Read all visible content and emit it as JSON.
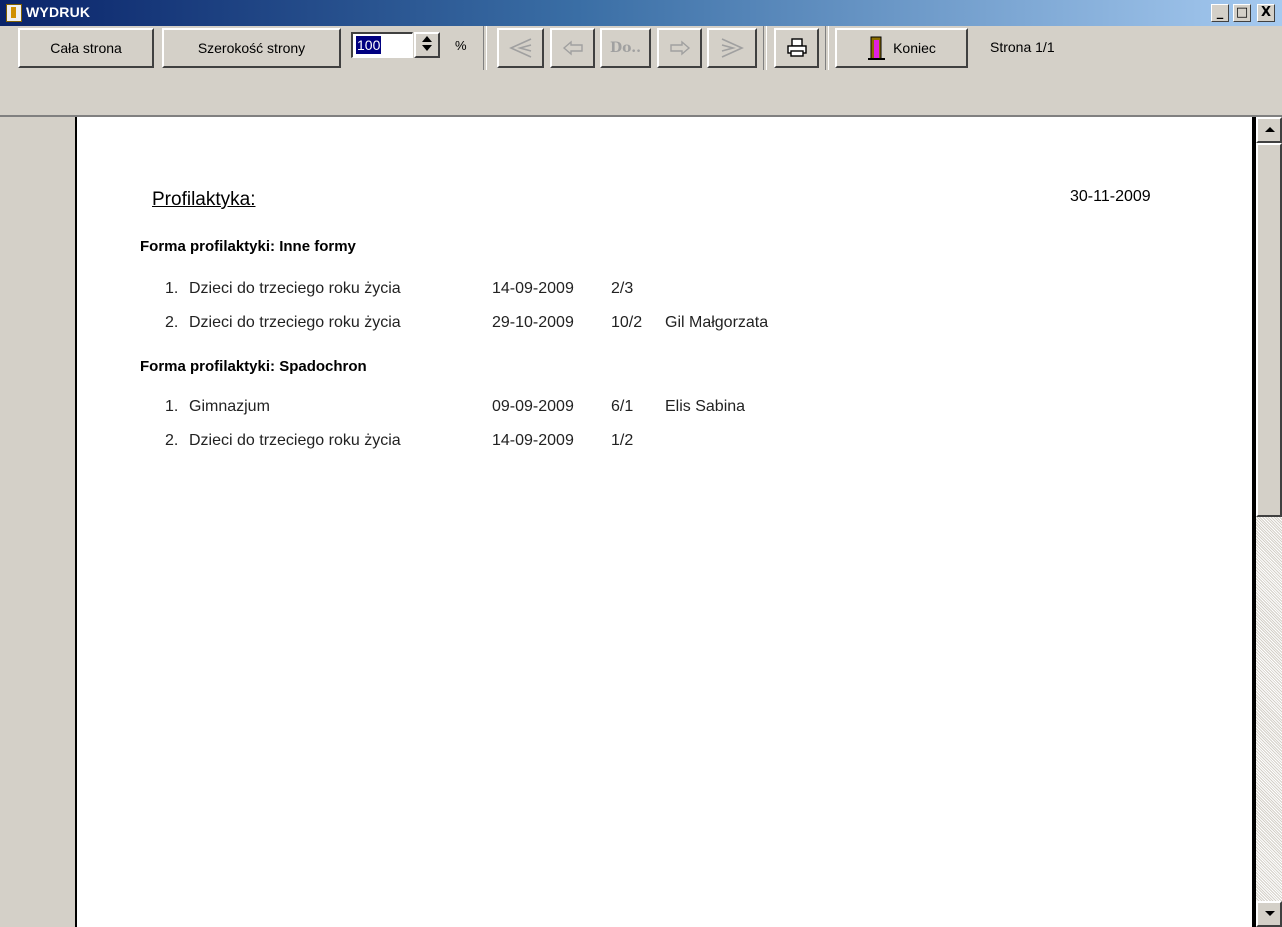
{
  "window": {
    "title": "WYDRUK",
    "icon": "book-icon",
    "controls": {
      "minimize": "_",
      "maximize": "□",
      "close": "X"
    }
  },
  "toolbar": {
    "whole_page_label": "Cała strona",
    "page_width_label": "Szerokość strony",
    "zoom_value": "100",
    "zoom_unit": "%",
    "first_page_icon": "first-page-icon",
    "prev_page_icon": "prev-page-icon",
    "goto_label": "Do..",
    "next_page_icon": "next-page-icon",
    "last_page_icon": "last-page-icon",
    "print_icon": "printer-icon",
    "exit_label": "Koniec",
    "exit_icon": "exit-door-icon",
    "page_status": "Strona 1/1"
  },
  "document": {
    "title": "Profilaktyka:",
    "date": "30-11-2009",
    "groups": [
      {
        "heading": "Forma profilaktyki:  Inne formy",
        "rows": [
          {
            "no": "1.",
            "name": "Dzieci do trzeciego roku życia",
            "date": "14-09-2009",
            "code": "2/3",
            "person": ""
          },
          {
            "no": "2.",
            "name": "Dzieci do trzeciego roku życia",
            "date": "29-10-2009",
            "code": "10/2",
            "person": "Gil Małgorzata"
          }
        ]
      },
      {
        "heading": "Forma profilaktyki:  Spadochron",
        "rows": [
          {
            "no": "1.",
            "name": "Gimnazjum",
            "date": "09-09-2009",
            "code": "6/1",
            "person": "Elis Sabina"
          },
          {
            "no": "2.",
            "name": "Dzieci do trzeciego roku życia",
            "date": "14-09-2009",
            "code": "1/2",
            "person": ""
          }
        ]
      }
    ]
  },
  "colors": {
    "titlebar_start": "#0a246a",
    "titlebar_end": "#a6caf0",
    "face": "#d4d0c8",
    "selection": "#000080"
  }
}
